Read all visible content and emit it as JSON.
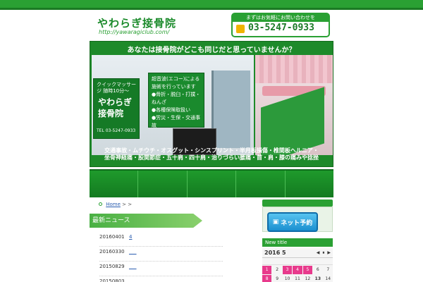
{
  "header": {
    "logo_title": "やわらぎ接骨院",
    "logo_url": "http://yawaragiclub.com/",
    "phone_note": "まずはお気軽にお問い合わせを",
    "phone_number": "03-5247-0933"
  },
  "hero": {
    "caption": "あなたは接骨院がどこも同じだと思っていませんか？",
    "sign_intro": "クイックマッサージ 随時10分〜",
    "sign_title_1": "やわらぎ",
    "sign_title_2": "接骨院",
    "sign_tel": "TEL 03-5247-0933",
    "services": [
      "超音波(エコー)による",
      "施術を行っています",
      "●骨折・脱臼・打撲・ねんざ",
      "●各種保険取扱い",
      "●労災・生保・交通事故"
    ],
    "conditions_line1": "交通事故・ムチウチ・オスグット・シンスプリント・半月板損傷・椎間板ヘルニア・",
    "conditions_line2": "坐骨神経痛・股関節症・五十肩・四十肩・治りづらい腰痛・首・肩・膝の痛みや捻挫"
  },
  "nav": {
    "items": [
      "",
      "",
      "",
      "",
      ""
    ]
  },
  "breadcrumb": {
    "home": "Home",
    "sep1": ">",
    "sep2": ">"
  },
  "news": {
    "heading": "最新ニュース",
    "items": [
      {
        "date": "20160401",
        "title": "4"
      },
      {
        "date": "20160330",
        "title": "___"
      },
      {
        "date": "20150829",
        "title": "___"
      },
      {
        "date": "20150803",
        "title": "___"
      }
    ]
  },
  "sidebar": {
    "reserve_label": "ネット予約",
    "new_title": "New title",
    "calendar": {
      "title": "2016 5",
      "nav": [
        "◀",
        "⏸",
        "▶"
      ],
      "week1": [
        "1",
        "2",
        "3",
        "4",
        "5",
        "6",
        "7"
      ],
      "week2": [
        "8",
        "9",
        "10",
        "11",
        "12",
        "13",
        "14"
      ]
    }
  },
  "colors": {
    "brand_green": "#2aa033",
    "accent_pink": "#e83a8c"
  }
}
